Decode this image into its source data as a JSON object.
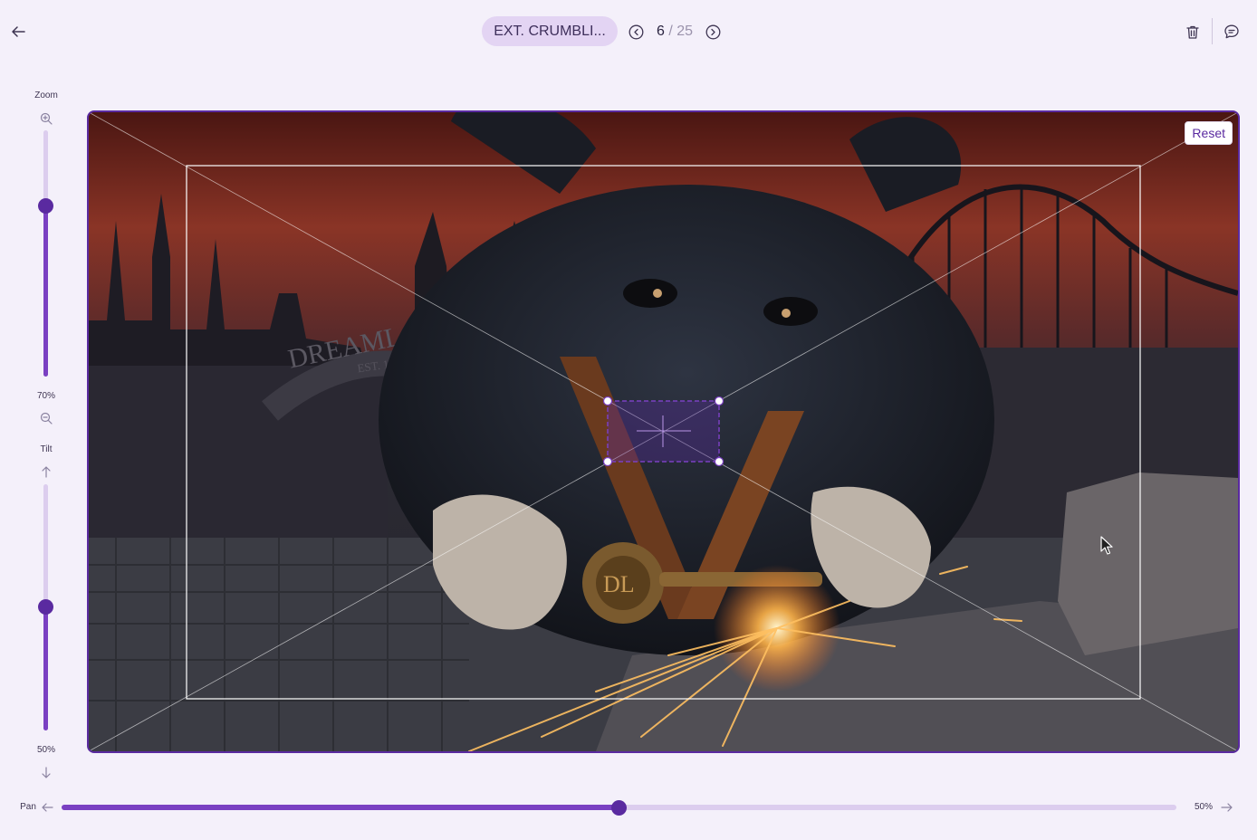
{
  "header": {
    "shot_name": "EXT. CRUMBLI...",
    "counter": {
      "current": "6",
      "separator": "/",
      "total": "25"
    }
  },
  "controls": {
    "zoom": {
      "label": "Zoom",
      "value_label": "70%",
      "value": 0.7
    },
    "tilt": {
      "label": "Tilt",
      "value_label": "50%",
      "value": 0.5
    },
    "pan": {
      "label": "Pan",
      "value_label": "50%",
      "value": 0.5
    }
  },
  "canvas": {
    "reset_label": "Reset",
    "sign_text": "DREAMLAND",
    "sign_sub": "EST. 1968",
    "key_text": "DL"
  },
  "colors": {
    "accent": "#5a2aa0",
    "accent_fill": "#7a40c2",
    "track": "#dccdee",
    "pill": "#e3d4f3",
    "background": "#f4f0fa"
  },
  "icons": {
    "back": "arrow-left-icon",
    "prev": "chevron-circle-left-icon",
    "next": "chevron-circle-right-icon",
    "delete": "trash-icon",
    "comment": "comment-icon",
    "zoom_in": "zoom-in-icon",
    "zoom_out": "zoom-out-icon",
    "tilt_up": "arrow-up-icon",
    "tilt_down": "arrow-down-icon",
    "pan_left": "arrow-left-icon",
    "pan_right": "arrow-right-icon"
  }
}
